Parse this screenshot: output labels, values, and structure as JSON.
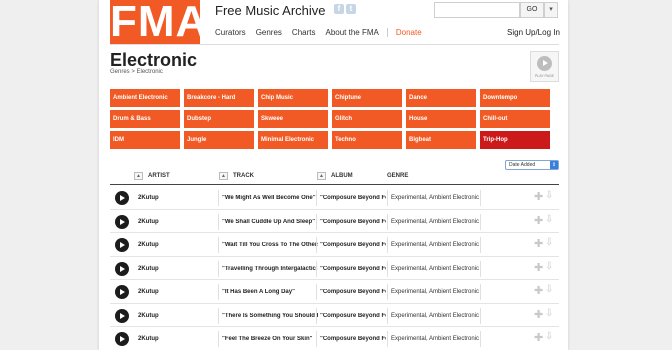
{
  "header": {
    "logo": "FMA",
    "site_title": "Free Music Archive",
    "social": [
      "f",
      "t"
    ],
    "search": {
      "value": "",
      "button": "GO",
      "dropdown": "▾"
    },
    "nav": [
      "Curators",
      "Genres",
      "Charts",
      "About the FMA",
      "Donate"
    ],
    "signup": "Sign Up/Log In"
  },
  "page": {
    "title": "Electronic",
    "breadcrumb": "Genres > Electronic",
    "play_all_label": "PLAY PAGE"
  },
  "genres": [
    "Ambient Electronic",
    "Breakcore - Hard",
    "Chip Music",
    "Chiptune",
    "Dance",
    "Downtempo",
    "Drum & Bass",
    "Dubstep",
    "Skweee",
    "Glitch",
    "House",
    "Chill-out",
    "IDM",
    "Jungle",
    "Minimal Electronic",
    "Techno",
    "Bigbeat",
    "Trip-Hop"
  ],
  "active_genre": "Trip-Hop",
  "sort": {
    "selected": "Date Added"
  },
  "table": {
    "columns": [
      "ARTIST",
      "TRACK",
      "ALBUM",
      "GENRE"
    ],
    "rows": [
      {
        "artist": "2Kutup",
        "track": "\"We Might As Well Become One\"",
        "album": "\"Composure Beyond Fence\"",
        "genre": "Experimental, Ambient Electronic"
      },
      {
        "artist": "2Kutup",
        "track": "\"We Shall Cuddle Up And Sleep\"",
        "album": "\"Composure Beyond Fence\"",
        "genre": "Experimental, Ambient Electronic"
      },
      {
        "artist": "2Kutup",
        "track": "\"Wait Till You Cross To The Otherside\"",
        "album": "\"Composure Beyond Fence\"",
        "genre": "Experimental, Ambient Electronic"
      },
      {
        "artist": "2Kutup",
        "track": "\"Travelling Through Intergalactic Space\"",
        "album": "\"Composure Beyond Fence\"",
        "genre": "Experimental, Ambient Electronic"
      },
      {
        "artist": "2Kutup",
        "track": "\"It Has Been A Long Day\"",
        "album": "\"Composure Beyond Fence\"",
        "genre": "Experimental, Ambient Electronic"
      },
      {
        "artist": "2Kutup",
        "track": "\"There Is Something You Should Know\"",
        "album": "\"Composure Beyond Fence\"",
        "genre": "Experimental, Ambient Electronic"
      },
      {
        "artist": "2Kutup",
        "track": "\"Feel The Breeze On Your Skin\"",
        "album": "\"Composure Beyond Fence\"",
        "genre": "Experimental, Ambient Electronic"
      }
    ]
  },
  "colors": {
    "brand": "#f15a24",
    "active": "#cc1a1a"
  },
  "icons": {
    "play": "play-icon",
    "add": "plus-icon",
    "download": "download-arrow-icon"
  }
}
